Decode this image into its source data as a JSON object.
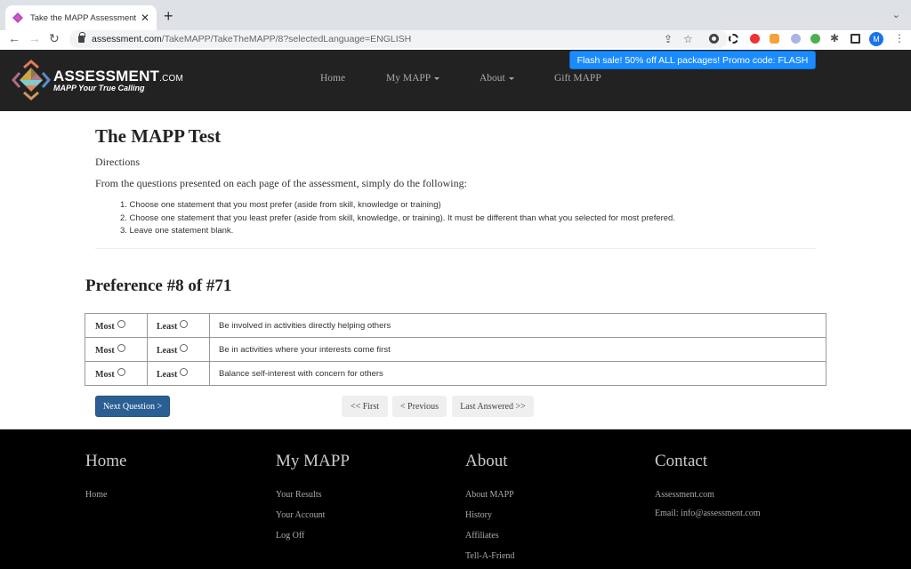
{
  "browser": {
    "tab_title": "Take the MAPP Assessment - A",
    "url_host": "assessment.com",
    "url_path": "/TakeMAPP/TakeTheMAPP/8?selectedLanguage=ENGLISH",
    "profile_initial": "M"
  },
  "header": {
    "logo_name": "ASSESSMENT",
    "logo_suffix": ".COM",
    "logo_tagline": "MAPP Your True Calling",
    "nav": [
      {
        "label": "Home"
      },
      {
        "label": "My MAPP"
      },
      {
        "label": "About"
      },
      {
        "label": "Gift MAPP"
      }
    ],
    "promo": "Flash sale! 50% off ALL packages! Promo code: FLASH"
  },
  "content": {
    "title": "The MAPP Test",
    "directions_label": "Directions",
    "intro": "From the questions presented on each page of the assessment, simply do the following:",
    "steps": [
      "1. Choose one statement that you most prefer (aside from skill, knowledge or training)",
      "2. Choose one statement that you least prefer (aside from skill, knowledge, or training). It must be different than what you selected for most prefered.",
      "3. Leave one statement blank."
    ],
    "preference_title": "Preference #8 of #71",
    "most_label": "Most",
    "least_label": "Least",
    "statements": [
      "Be involved in activities directly helping others",
      "Be in activities where your interests come first",
      "Balance self-interest with concern for others"
    ],
    "buttons": {
      "next": "Next Question >",
      "first": "<< First",
      "previous": "< Previous",
      "last_answered": "Last Answered >>"
    }
  },
  "footer": {
    "columns": [
      {
        "heading": "Home",
        "links": [
          "Home"
        ]
      },
      {
        "heading": "My MAPP",
        "links": [
          "Your Results",
          "Your Account",
          "Log Off"
        ]
      },
      {
        "heading": "About",
        "links": [
          "About MAPP",
          "History",
          "Affiliates",
          "Tell-A-Friend"
        ]
      },
      {
        "heading": "Contact",
        "lines": [
          "Assessment.com",
          "Email: info@assessment.com"
        ]
      }
    ]
  },
  "colors": {
    "header_bg": "#222222",
    "primary_button": "#2b5f94",
    "promo_bg": "#1a8cff",
    "footer_bg": "#000000"
  }
}
